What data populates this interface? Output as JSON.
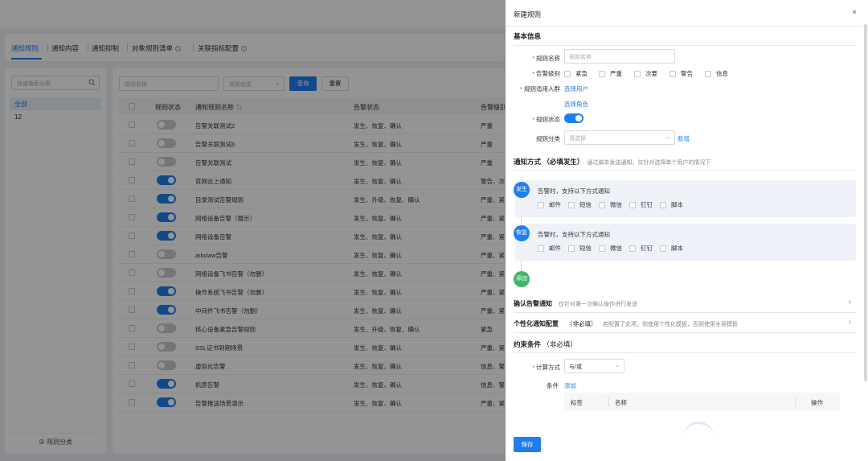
{
  "tabs": [
    {
      "label": "通知规则",
      "active": true
    },
    {
      "label": "通知内容",
      "active": false
    },
    {
      "label": "通知抑制",
      "active": false
    },
    {
      "label": "对象规则清单",
      "active": false,
      "info": true
    },
    {
      "label": "关联指标配置",
      "active": false,
      "info": true
    }
  ],
  "left_panel": {
    "search_placeholder": "快速搜索分类",
    "tree": [
      "全部",
      "12"
    ],
    "footer": "规则分类"
  },
  "filters": {
    "name_placeholder": "规则名称",
    "status_placeholder": "规则状态",
    "query_label": "查询",
    "reset_label": "重置"
  },
  "table": {
    "headers": [
      "规则状态",
      "通知规则名称",
      "告警状态",
      "告警级别"
    ],
    "rows": [
      {
        "on": false,
        "name": "告警关联测试2",
        "status": "发生、恢复、确认",
        "level": "严重"
      },
      {
        "on": false,
        "name": "告警关联测试6",
        "status": "发生、恢复、确认",
        "level": "严重"
      },
      {
        "on": false,
        "name": "告警关联测试",
        "status": "发生、恢复、确认",
        "level": "严重"
      },
      {
        "on": true,
        "name": "官网云上通知",
        "status": "发生、恢复、确认",
        "level": "警告、次"
      },
      {
        "on": true,
        "name": "目录测试告警规则",
        "status": "发生、升级、恢复、确认",
        "level": "严重、紧"
      },
      {
        "on": true,
        "name": "网络设备告警（展示）",
        "status": "发生、恢复、确认",
        "level": "严重、紧"
      },
      {
        "on": true,
        "name": "网络设备告警",
        "status": "发生、恢复、确认",
        "level": "严重、紧"
      },
      {
        "on": false,
        "name": "arkclaw告警",
        "status": "发生、恢复、确认",
        "level": "严重、紧"
      },
      {
        "on": false,
        "name": "网络设备飞书告警（勿删）",
        "status": "发生、恢复、确认",
        "level": "严重、紧"
      },
      {
        "on": true,
        "name": "操作系统飞书告警（勿删）",
        "status": "发生、恢复、确认",
        "level": "严重、紧"
      },
      {
        "on": true,
        "name": "中间件飞书告警（勿删）",
        "status": "发生、恢复、确认",
        "level": "严重、紧"
      },
      {
        "on": false,
        "name": "核心设备紧急告警规则",
        "status": "发生、升级、恢复、确认",
        "level": "紧急"
      },
      {
        "on": false,
        "name": "SSL证书到期场景",
        "status": "发生、恢复、确认",
        "level": "严重、紧"
      },
      {
        "on": false,
        "name": "虚拟化告警",
        "status": "发生、恢复、确认",
        "level": "信息、警"
      },
      {
        "on": true,
        "name": "机房告警",
        "status": "发生、恢复、确认",
        "level": "信息、警"
      },
      {
        "on": true,
        "name": "告警推送场景演示",
        "status": "发生、恢复、确认",
        "level": "严重、紧"
      }
    ]
  },
  "drawer": {
    "title": "新建规则",
    "close": "×",
    "basic": {
      "heading": "基本信息",
      "name_label": "规则名称",
      "name_placeholder": "规则名称",
      "level_label": "告警级别",
      "levels": [
        "紧急",
        "严重",
        "次要",
        "警告",
        "信息"
      ],
      "scope_label": "规则适用人群",
      "select_user": "选择用户",
      "select_role": "选择角色",
      "status_label": "规则状态",
      "status_on": true,
      "category_label": "规则分类",
      "category_placeholder": "请选择",
      "add_new": "新增"
    },
    "notify": {
      "heading": "通知方式",
      "heading_note": "（必填发生）",
      "hint": "通过脚本发送通知，仅针对选择单个用户的情况下",
      "stages": [
        {
          "tag": "发生",
          "desc": "告警时，支持以下方式通知",
          "channels": [
            "邮件",
            "短信",
            "微信",
            "钉钉",
            "脚本"
          ]
        },
        {
          "tag": "恢复",
          "desc": "告警时，支持以下方式通知",
          "channels": [
            "邮件",
            "短信",
            "微信",
            "钉钉",
            "脚本"
          ]
        }
      ],
      "add_tag": "添加"
    },
    "confirm": {
      "title": "确认告警通知",
      "hint": "仅针对第一次确认操作进行发送"
    },
    "personal": {
      "title": "个性化通知配置",
      "note": "（非必填）",
      "hint": "若配置了此项，则使用个性化模板，否则使用全局模板"
    },
    "constraint": {
      "heading": "约束条件",
      "note": "（非必填）",
      "calc_label": "计算方式",
      "calc_value": "与/或",
      "cond_label": "条件",
      "cond_add": "添加",
      "cols": [
        "标签",
        "名称",
        "操作"
      ]
    },
    "save": "保存"
  }
}
